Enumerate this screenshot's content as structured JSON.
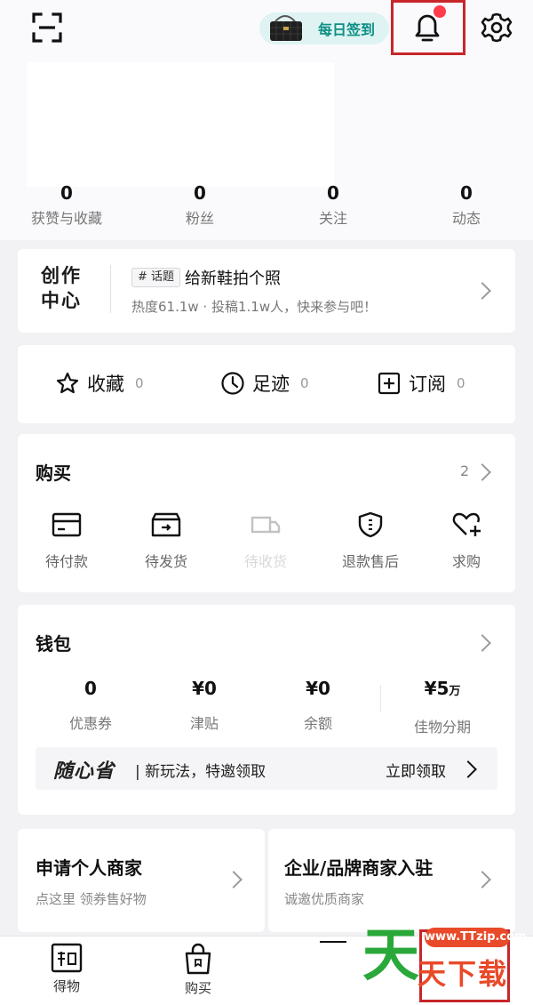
{
  "header": {
    "signin_label": "每日签到"
  },
  "stats": [
    {
      "value": "0",
      "label": "获赞与收藏"
    },
    {
      "value": "0",
      "label": "粉丝"
    },
    {
      "value": "0",
      "label": "关注"
    },
    {
      "value": "0",
      "label": "动态"
    }
  ],
  "creator": {
    "title_line1": "创作",
    "title_line2": "中心",
    "tag": "# 话题",
    "topic": "给新鞋拍个照",
    "subtitle": "热度61.1w · 投稿1.1w人，快来参与吧！"
  },
  "quick_links": [
    {
      "label": "收藏",
      "count": "0",
      "icon": "star-icon"
    },
    {
      "label": "足迹",
      "count": "0",
      "icon": "clock-icon"
    },
    {
      "label": "订阅",
      "count": "0",
      "icon": "plus-box-icon"
    }
  ],
  "purchase": {
    "title": "购买",
    "count": "2",
    "items": [
      {
        "label": "待付款",
        "icon": "card-icon"
      },
      {
        "label": "待发货",
        "icon": "box-icon"
      },
      {
        "label": "待收货",
        "icon": "truck-icon"
      },
      {
        "label": "退款售后",
        "icon": "shield-icon"
      },
      {
        "label": "求购",
        "icon": "heart-plus-icon"
      }
    ]
  },
  "wallet": {
    "title": "钱包",
    "items": [
      {
        "value": "0",
        "unit": "",
        "label": "优惠券"
      },
      {
        "value": "¥0",
        "unit": "",
        "label": "津贴"
      },
      {
        "value": "¥0",
        "unit": "",
        "label": "余额"
      },
      {
        "value": "¥5",
        "unit": "万",
        "label": "佳物分期"
      }
    ],
    "promo_logo": "随心省",
    "promo_text": "| 新玩法，特邀领取",
    "promo_cta": "立即领取"
  },
  "merchant": {
    "personal_title": "申请个人商家",
    "personal_sub": "点这里 领券售好物",
    "enterprise_title": "企业/品牌商家入驻",
    "enterprise_sub": "诚邀优质商家"
  },
  "bottom_nav": [
    {
      "label": "得物",
      "icon": "dewu-logo-icon"
    },
    {
      "label": "购买",
      "icon": "shopping-bag-icon"
    }
  ],
  "watermark": {
    "url": "www.TTzip.com",
    "big": "天",
    "small": "天下载"
  },
  "colors": {
    "accent_teal": "#0e8f86",
    "highlight_red": "#c8262a",
    "notify_dot": "#ff3b4c"
  }
}
